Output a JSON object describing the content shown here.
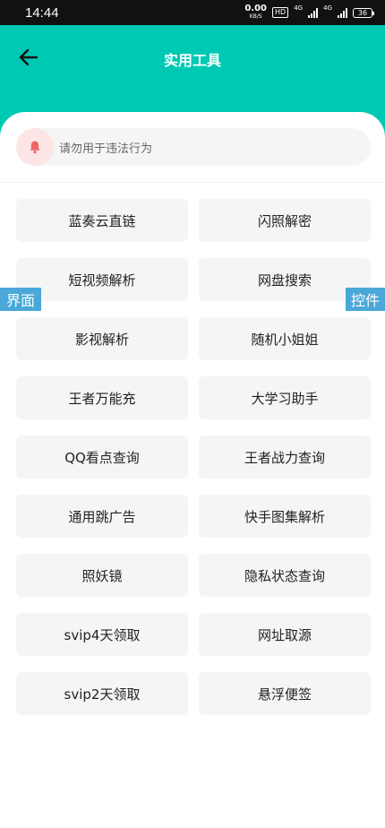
{
  "status": {
    "time": "14:44",
    "net_speed": "0.00",
    "net_unit": "KB/S",
    "hd": "HD",
    "signal1": "4G",
    "signal2": "4G",
    "battery": "36"
  },
  "header": {
    "title": "实用工具",
    "back_icon": "arrow-left-icon"
  },
  "notice": {
    "icon": "bell-icon",
    "text": "请勿用于违法行为"
  },
  "tools": [
    "蓝奏云直链",
    "闪照解密",
    "短视频解析",
    "网盘搜索",
    "影视解析",
    "随机小姐姐",
    "王者万能充",
    "大学习助手",
    "QQ看点查询",
    "王者战力查询",
    "通用跳广告",
    "快手图集解析",
    "照妖镜",
    "隐私状态查询",
    "svip4天领取",
    "网址取源",
    "svip2天领取",
    "悬浮便签"
  ],
  "side_tags": {
    "left": "界面",
    "right": "控件"
  },
  "colors": {
    "header": "#00c9b3",
    "bell": "#f06464",
    "side_tag": "#4aa8d8"
  }
}
